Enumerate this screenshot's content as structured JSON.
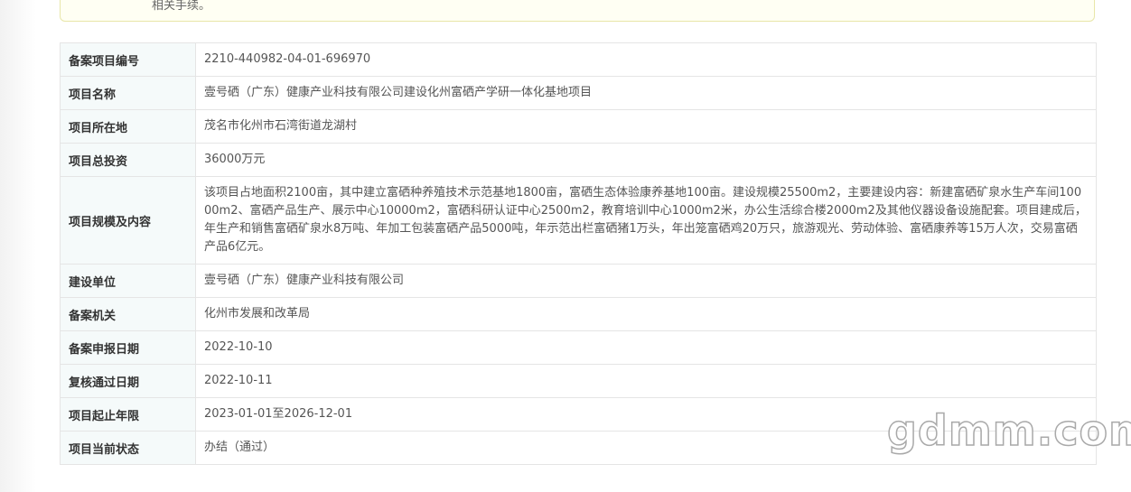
{
  "notice": {
    "text": "相关手续。"
  },
  "table": {
    "rows": [
      {
        "label": "备案项目编号",
        "value": "2210-440982-04-01-696970"
      },
      {
        "label": "项目名称",
        "value": "壹号硒（广东）健康产业科技有限公司建设化州富硒产学研一体化基地项目"
      },
      {
        "label": "项目所在地",
        "value": "茂名市化州市石湾街道龙湖村"
      },
      {
        "label": "项目总投资",
        "value": "36000万元"
      },
      {
        "label": "项目规模及内容",
        "value": "该项目占地面积2100亩，其中建立富硒种养殖技术示范基地1800亩，富硒生态体验康养基地100亩。建设规模25500m2，主要建设内容：新建富硒矿泉水生产车间10000m2、富硒产品生产、展示中心10000m2，富硒科研认证中心2500m2，教育培训中心1000m2米，办公生活综合楼2000m2及其他仪器设备设施配套。项目建成后，年生产和销售富硒矿泉水8万吨、年加工包装富硒产品5000吨，年示范出栏富硒猪1万头，年出笼富硒鸡20万只，旅游观光、劳动体验、富硒康养等15万人次，交易富硒产品6亿元。"
      },
      {
        "label": "建设单位",
        "value": "壹号硒（广东）健康产业科技有限公司"
      },
      {
        "label": "备案机关",
        "value": "化州市发展和改革局"
      },
      {
        "label": "备案申报日期",
        "value": "2022-10-10"
      },
      {
        "label": "复核通过日期",
        "value": "2022-10-11"
      },
      {
        "label": "项目起止年限",
        "value": "2023-01-01至2026-12-01"
      },
      {
        "label": "项目当前状态",
        "value": "办结（通过）"
      }
    ]
  },
  "watermark": {
    "text": "gdmm.com"
  }
}
